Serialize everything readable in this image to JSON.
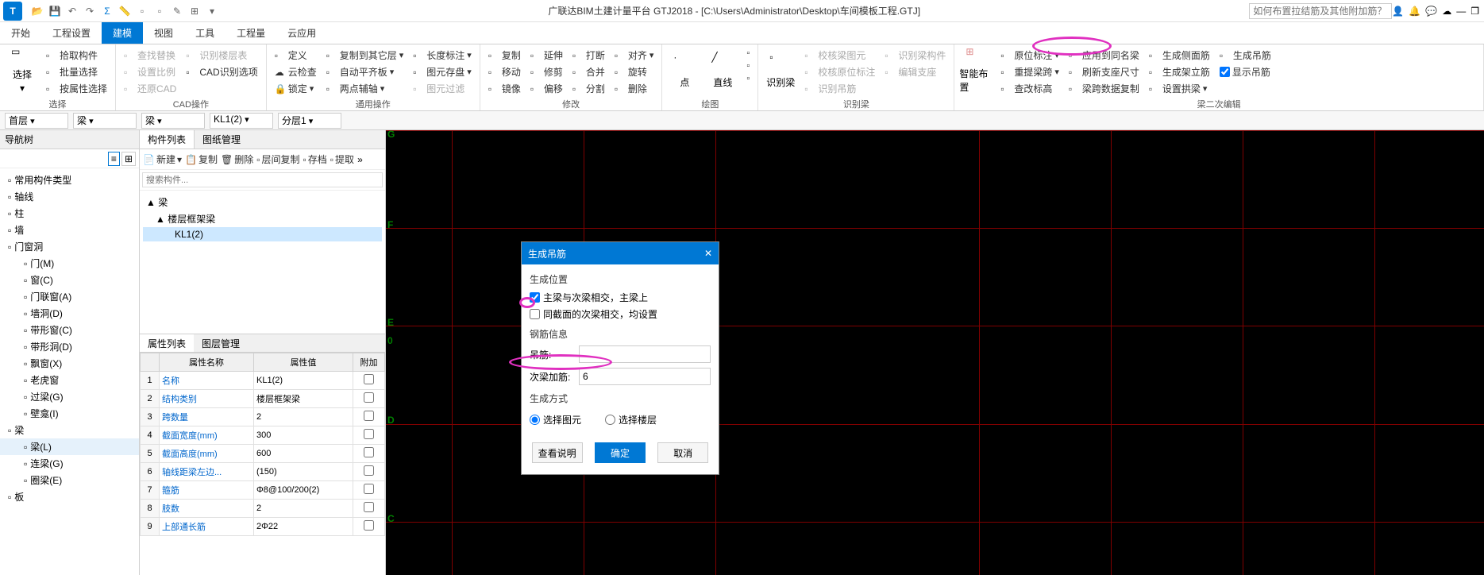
{
  "title": "广联达BIM土建计量平台 GTJ2018 - [C:\\Users\\Administrator\\Desktop\\车间模板工程.GTJ]",
  "search_placeholder": "如何布置拉结筋及其他附加筋？",
  "menu": [
    "开始",
    "工程设置",
    "建模",
    "视图",
    "工具",
    "工程量",
    "云应用"
  ],
  "menu_active": 2,
  "ribbon": {
    "g1": {
      "title": "选择",
      "items": [
        "拾取构件",
        "批量选择",
        "按属性选择",
        "选择"
      ]
    },
    "g2": {
      "title": "CAD操作",
      "items": [
        "查找替换",
        "设置比例",
        "还原CAD",
        "识别楼层表",
        "CAD识别选项",
        "复制到其它层",
        "自动平齐板",
        "两点辅轴",
        "锁定",
        "定义",
        "云检查",
        "长度标注",
        "图元存盘",
        "图元过滤"
      ]
    },
    "g3": {
      "title": "通用操作"
    },
    "g4": {
      "title": "修改",
      "items": [
        "复制",
        "移动",
        "镜像",
        "延伸",
        "修剪",
        "偏移",
        "打断",
        "合并",
        "分割",
        "对齐",
        "旋转",
        "删除"
      ]
    },
    "g5": {
      "title": "绘图",
      "items": [
        "点",
        "直线"
      ]
    },
    "g6": {
      "title": "识别梁",
      "items": [
        "识别梁",
        "校核梁图元",
        "校核原位标注",
        "识别吊筋",
        "识别梁构件",
        "编辑支座"
      ]
    },
    "g7": {
      "title": "梁二次编辑",
      "big": "智能布置",
      "items": [
        "原位标注",
        "重提梁跨",
        "查改标高",
        "应用到同名梁",
        "刷新支座尺寸",
        "梁跨数据复制",
        "生成侧面筋",
        "生成架立筋",
        "设置拱梁",
        "生成吊筋",
        "显示吊筋"
      ]
    }
  },
  "subbar": {
    "floor": "首层",
    "cat": "梁",
    "type": "梁",
    "member": "KL1(2)",
    "span": "分层1"
  },
  "nav": {
    "title": "导航树",
    "items": [
      {
        "label": "常用构件类型",
        "lvl": 1
      },
      {
        "label": "轴线",
        "lvl": 1
      },
      {
        "label": "柱",
        "lvl": 1
      },
      {
        "label": "墙",
        "lvl": 1
      },
      {
        "label": "门窗洞",
        "lvl": 1
      },
      {
        "label": "门(M)",
        "lvl": 2
      },
      {
        "label": "窗(C)",
        "lvl": 2
      },
      {
        "label": "门联窗(A)",
        "lvl": 2
      },
      {
        "label": "墙洞(D)",
        "lvl": 2
      },
      {
        "label": "带形窗(C)",
        "lvl": 2
      },
      {
        "label": "带形洞(D)",
        "lvl": 2
      },
      {
        "label": "飘窗(X)",
        "lvl": 2
      },
      {
        "label": "老虎窗",
        "lvl": 2
      },
      {
        "label": "过梁(G)",
        "lvl": 2
      },
      {
        "label": "壁龛(I)",
        "lvl": 2
      },
      {
        "label": "梁",
        "lvl": 1
      },
      {
        "label": "梁(L)",
        "lvl": 2,
        "sel": true
      },
      {
        "label": "连梁(G)",
        "lvl": 2
      },
      {
        "label": "圈梁(E)",
        "lvl": 2
      },
      {
        "label": "板",
        "lvl": 1
      }
    ]
  },
  "mid": {
    "tabs": [
      "构件列表",
      "图纸管理"
    ],
    "toolbar": [
      "新建",
      "复制",
      "删除",
      "层间复制",
      "存档",
      "提取"
    ],
    "search_ph": "搜索构件...",
    "tree": [
      "▲ 梁",
      "  ▲ 楼层框架梁",
      "      KL1(2)"
    ],
    "prop_tabs": [
      "属性列表",
      "图层管理"
    ],
    "prop_head": [
      "属性名称",
      "属性值",
      "附加"
    ],
    "props": [
      {
        "n": "1",
        "name": "名称",
        "val": "KL1(2)"
      },
      {
        "n": "2",
        "name": "结构类别",
        "val": "楼层框架梁"
      },
      {
        "n": "3",
        "name": "跨数量",
        "val": "2"
      },
      {
        "n": "4",
        "name": "截面宽度(mm)",
        "val": "300"
      },
      {
        "n": "5",
        "name": "截面高度(mm)",
        "val": "600"
      },
      {
        "n": "6",
        "name": "轴线距梁左边...",
        "val": "(150)"
      },
      {
        "n": "7",
        "name": "箍筋",
        "val": "Φ8@100/200(2)"
      },
      {
        "n": "8",
        "name": "肢数",
        "val": "2"
      },
      {
        "n": "9",
        "name": "上部通长筋",
        "val": "2Φ22"
      }
    ]
  },
  "canvas": {
    "labels": [
      "G",
      "F",
      "E",
      "D",
      "C"
    ],
    "zero": "0"
  },
  "dialog": {
    "title": "生成吊筋",
    "sect1": "生成位置",
    "chk1": "主梁与次梁相交，主梁上",
    "chk2": "同截面的次梁相交，均设置",
    "sect2": "钢筋信息",
    "l1": "吊筋:",
    "l2": "次梁加筋:",
    "v2": "6",
    "sect3": "生成方式",
    "r1": "选择图元",
    "r2": "选择楼层",
    "btns": [
      "查看说明",
      "确定",
      "取消"
    ]
  }
}
